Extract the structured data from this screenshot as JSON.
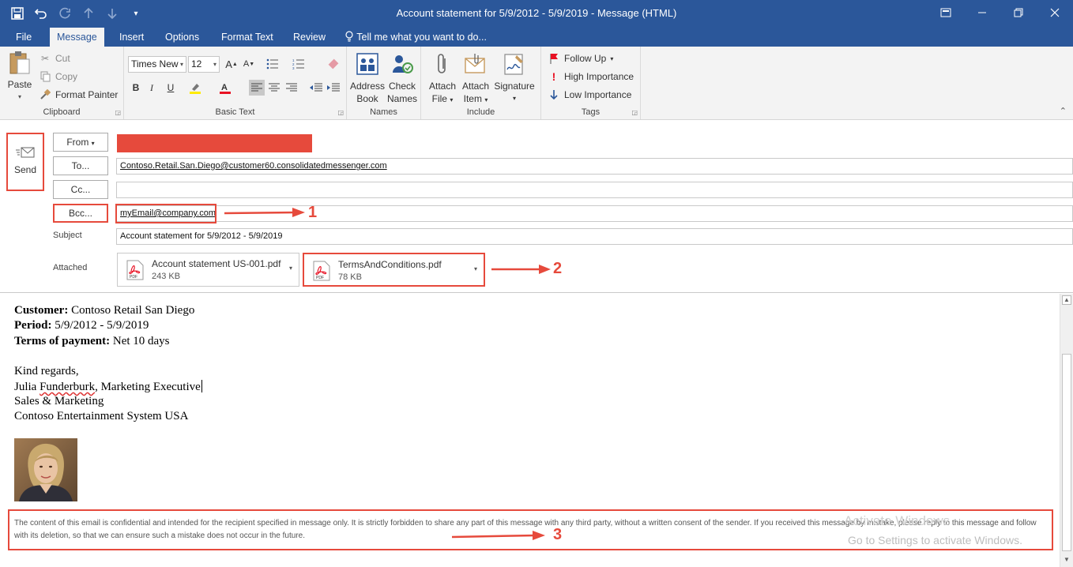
{
  "window": {
    "title": "Account statement for 5/9/2012 - 5/9/2019 - Message (HTML)",
    "icons": [
      "save-icon",
      "undo-icon",
      "redo-icon",
      "up-arrow-icon",
      "down-arrow-icon",
      "customize-icon"
    ]
  },
  "tabs": [
    {
      "label": "File"
    },
    {
      "label": "Message"
    },
    {
      "label": "Insert"
    },
    {
      "label": "Options"
    },
    {
      "label": "Format Text"
    },
    {
      "label": "Review"
    }
  ],
  "tell_me": "Tell me what you want to do...",
  "ribbon": {
    "clipboard": {
      "paste": "Paste",
      "cut": "Cut",
      "copy": "Copy",
      "format_painter": "Format Painter",
      "label": "Clipboard"
    },
    "basic_text": {
      "font": "Times New",
      "size": "12",
      "label": "Basic Text"
    },
    "names": {
      "address_book_1": "Address",
      "address_book_2": "Book",
      "check_names_1": "Check",
      "check_names_2": "Names",
      "label": "Names"
    },
    "include": {
      "attach_file_1": "Attach",
      "attach_file_2": "File",
      "attach_item_1": "Attach",
      "attach_item_2": "Item",
      "signature": "Signature",
      "label": "Include"
    },
    "tags": {
      "follow_up": "Follow Up",
      "high": "High Importance",
      "low": "Low Importance",
      "label": "Tags"
    }
  },
  "compose": {
    "send": "Send",
    "from_btn": "From",
    "to_btn": "To...",
    "cc_btn": "Cc...",
    "bcc_btn": "Bcc...",
    "to_value": "Contoso.Retail.San.Diego@customer60.consolidatedmessenger.com",
    "cc_value": "",
    "bcc_value": "myEmail@company.com",
    "subject_label": "Subject",
    "subject_value": "Account statement for 5/9/2012 - 5/9/2019",
    "attached_label": "Attached",
    "attachments": [
      {
        "name": "Account statement US-001.pdf",
        "size": "243 KB"
      },
      {
        "name": "TermsAndConditions.pdf",
        "size": "78 KB"
      }
    ]
  },
  "body": {
    "customer_label": "Customer:",
    "customer_value": " Contoso Retail San Diego",
    "period_label": "Period:",
    "period_value": " 5/9/2012 - 5/9/2019",
    "terms_label": "Terms of payment:",
    "terms_value": " Net 10 days",
    "regards": "Kind regards,",
    "sig_name_a": "Julia ",
    "sig_name_b": "Funderburk",
    "sig_name_c": ", Marketing Executive",
    "sig_dept": "Sales & Marketing",
    "sig_company": "Contoso Entertainment System USA",
    "disclaimer": "The content of this email is confidential and intended for the recipient specified in message only. It is strictly forbidden to share any part of this message with any third party, without a written consent of the sender. If you received this message by mistake, please reply to this message and follow with its deletion, so that we can ensure such a mistake does not occur in the future."
  },
  "annotations": [
    "1",
    "2",
    "3"
  ],
  "watermark": {
    "line1": "Activate Windows",
    "line2": "Go to Settings to activate Windows."
  },
  "colors": {
    "brand": "#2b579a",
    "annotation": "#e64a3c"
  }
}
